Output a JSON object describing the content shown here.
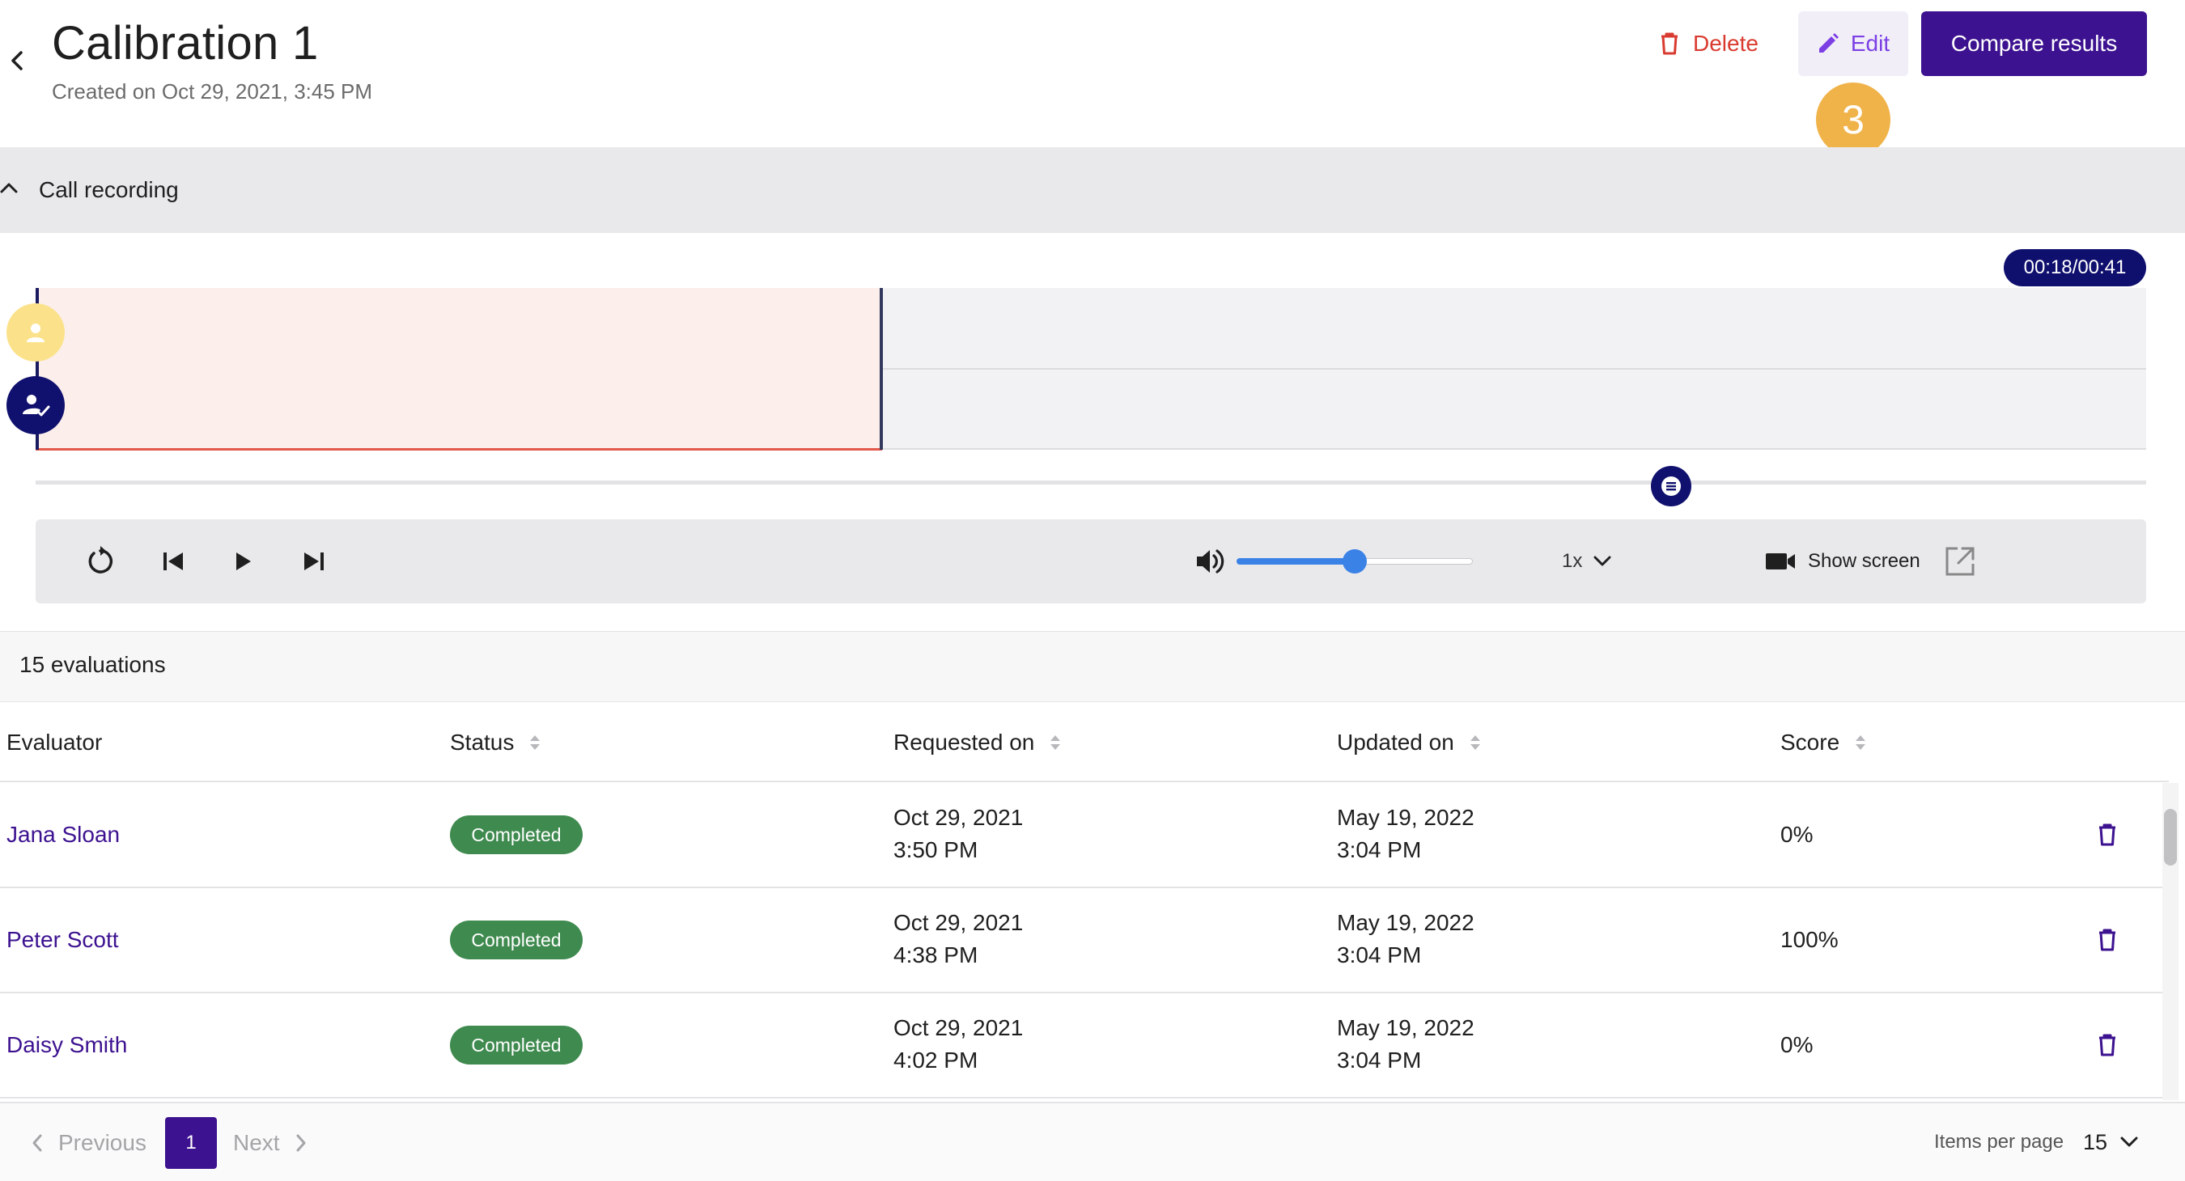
{
  "header": {
    "title": "Calibration 1",
    "subtitle": "Created on Oct 29, 2021, 3:45 PM",
    "delete_label": "Delete",
    "edit_label": "Edit",
    "compare_label": "Compare results",
    "step_badge": "3"
  },
  "recording": {
    "section_label": "Call recording",
    "time_display": "00:18/00:41",
    "playback_progress": 0.4,
    "volume_level": 0.5,
    "speed": "1x",
    "show_screen_label": "Show screen"
  },
  "evaluations": {
    "count_label": "15 evaluations",
    "columns": {
      "evaluator": "Evaluator",
      "status": "Status",
      "requested_on": "Requested on",
      "updated_on": "Updated on",
      "score": "Score"
    },
    "rows": [
      {
        "evaluator": "Jana Sloan",
        "status": "Completed",
        "requested_date": "Oct 29, 2021",
        "requested_time": "3:50 PM",
        "updated_date": "May 19, 2022",
        "updated_time": "3:04 PM",
        "score": "0%"
      },
      {
        "evaluator": "Peter Scott",
        "status": "Completed",
        "requested_date": "Oct 29, 2021",
        "requested_time": "4:38 PM",
        "updated_date": "May 19, 2022",
        "updated_time": "3:04 PM",
        "score": "100%"
      },
      {
        "evaluator": "Daisy Smith",
        "status": "Completed",
        "requested_date": "Oct 29, 2021",
        "requested_time": "4:02 PM",
        "updated_date": "May 19, 2022",
        "updated_time": "3:04 PM",
        "score": "0%"
      }
    ]
  },
  "pagination": {
    "previous_label": "Previous",
    "current_page": "1",
    "next_label": "Next",
    "items_per_page_label": "Items per page",
    "items_per_page_value": "15"
  },
  "colors": {
    "brand": "#3d1290",
    "delete": "#d93a2f",
    "completed": "#3f8a4f",
    "badge": "#f0b34a",
    "navy": "#10106e"
  },
  "icons": {
    "back": "chevron-left-icon",
    "delete": "trash-icon",
    "edit": "pencil-icon",
    "collapse": "chevron-up-icon",
    "customer": "person-icon",
    "agent": "person-check-icon",
    "comment": "comment-icon",
    "replay": "replay-icon",
    "skip_back": "skip-previous-icon",
    "play": "play-icon",
    "skip_forward": "skip-next-icon",
    "volume": "volume-icon",
    "video": "video-camera-icon",
    "external": "open-external-icon",
    "sort": "sort-icon"
  }
}
